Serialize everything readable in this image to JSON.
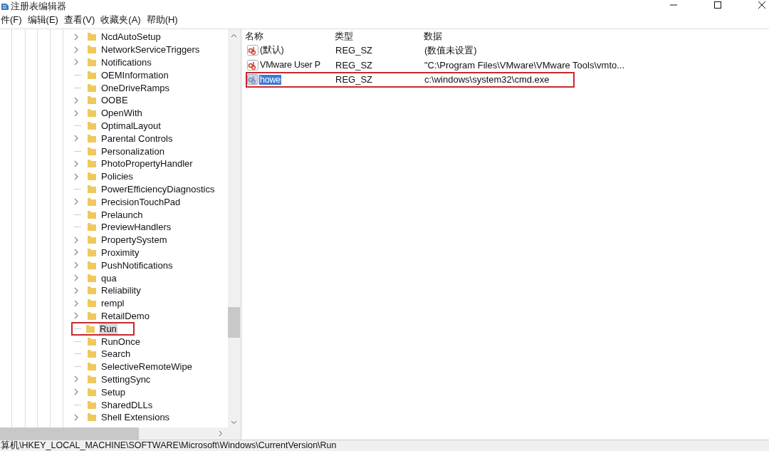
{
  "window": {
    "title": "注册表编辑器"
  },
  "menu": [
    "件(F)",
    "编辑(E)",
    "查看(V)",
    "收藏夹(A)",
    "帮助(H)"
  ],
  "tree": [
    {
      "label": "NcdAutoSetup",
      "expandable": true,
      "selected": false,
      "annotated": false
    },
    {
      "label": "NetworkServiceTriggers",
      "expandable": true,
      "selected": false,
      "annotated": false
    },
    {
      "label": "Notifications",
      "expandable": true,
      "selected": false,
      "annotated": false
    },
    {
      "label": "OEMInformation",
      "expandable": false,
      "selected": false,
      "annotated": false
    },
    {
      "label": "OneDriveRamps",
      "expandable": false,
      "selected": false,
      "annotated": false
    },
    {
      "label": "OOBE",
      "expandable": true,
      "selected": false,
      "annotated": false
    },
    {
      "label": "OpenWith",
      "expandable": true,
      "selected": false,
      "annotated": false
    },
    {
      "label": "OptimalLayout",
      "expandable": false,
      "selected": false,
      "annotated": false
    },
    {
      "label": "Parental Controls",
      "expandable": true,
      "selected": false,
      "annotated": false
    },
    {
      "label": "Personalization",
      "expandable": false,
      "selected": false,
      "annotated": false
    },
    {
      "label": "PhotoPropertyHandler",
      "expandable": true,
      "selected": false,
      "annotated": false
    },
    {
      "label": "Policies",
      "expandable": true,
      "selected": false,
      "annotated": false
    },
    {
      "label": "PowerEfficiencyDiagnostics",
      "expandable": false,
      "selected": false,
      "annotated": false
    },
    {
      "label": "PrecisionTouchPad",
      "expandable": true,
      "selected": false,
      "annotated": false
    },
    {
      "label": "Prelaunch",
      "expandable": false,
      "selected": false,
      "annotated": false
    },
    {
      "label": "PreviewHandlers",
      "expandable": false,
      "selected": false,
      "annotated": false
    },
    {
      "label": "PropertySystem",
      "expandable": true,
      "selected": false,
      "annotated": false
    },
    {
      "label": "Proximity",
      "expandable": true,
      "selected": false,
      "annotated": false
    },
    {
      "label": "PushNotifications",
      "expandable": true,
      "selected": false,
      "annotated": false
    },
    {
      "label": "qua",
      "expandable": true,
      "selected": false,
      "annotated": false
    },
    {
      "label": "Reliability",
      "expandable": true,
      "selected": false,
      "annotated": false
    },
    {
      "label": "rempl",
      "expandable": true,
      "selected": false,
      "annotated": false
    },
    {
      "label": "RetailDemo",
      "expandable": true,
      "selected": false,
      "annotated": false
    },
    {
      "label": "Run",
      "expandable": false,
      "selected": true,
      "annotated": true
    },
    {
      "label": "RunOnce",
      "expandable": false,
      "selected": false,
      "annotated": false
    },
    {
      "label": "Search",
      "expandable": false,
      "selected": false,
      "annotated": false
    },
    {
      "label": "SelectiveRemoteWipe",
      "expandable": false,
      "selected": false,
      "annotated": false
    },
    {
      "label": "SettingSync",
      "expandable": true,
      "selected": false,
      "annotated": false
    },
    {
      "label": "Setup",
      "expandable": true,
      "selected": false,
      "annotated": false
    },
    {
      "label": "SharedDLLs",
      "expandable": false,
      "selected": false,
      "annotated": false
    },
    {
      "label": "Shell Extensions",
      "expandable": true,
      "selected": false,
      "annotated": false
    }
  ],
  "table": {
    "columns": [
      "名称",
      "类型",
      "数据"
    ],
    "rows": [
      {
        "name": "(默认)",
        "type": "REG_SZ",
        "data": "(数值未设置)",
        "selected": false,
        "annotated": false
      },
      {
        "name": "VMware User P",
        "type": "REG_SZ",
        "data": "\"C:\\Program Files\\VMware\\VMware Tools\\vmto...",
        "selected": false,
        "annotated": false
      },
      {
        "name": "howe",
        "type": "REG_SZ",
        "data": "c:\\windows\\system32\\cmd.exe",
        "selected": true,
        "annotated": true
      }
    ]
  },
  "status_bar": "算机\\HKEY_LOCAL_MACHINE\\SOFTWARE\\Microsoft\\Windows\\CurrentVersion\\Run"
}
